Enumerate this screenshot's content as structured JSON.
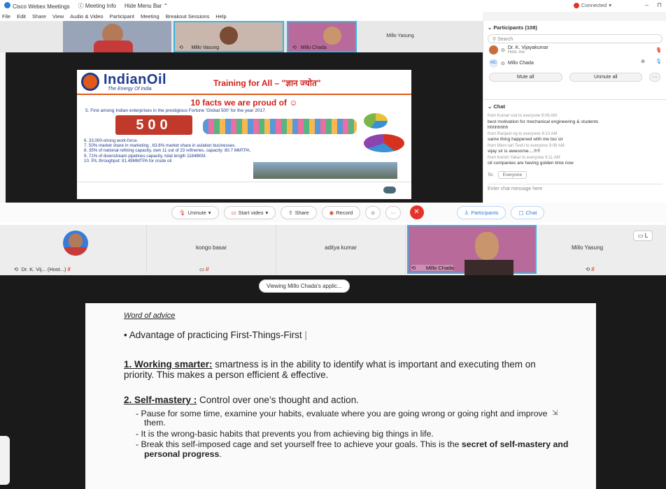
{
  "top": {
    "titlebar": {
      "app": "Cisco Webex Meetings",
      "info": "Meeting Info",
      "hide": "Hide Menu Bar",
      "connected": "Connected"
    },
    "menu": [
      "File",
      "Edit",
      "Share",
      "View",
      "Audio & Video",
      "Participant",
      "Meeting",
      "Breakout Sessions",
      "Help"
    ],
    "thumbs": [
      "",
      "Millo Vasung",
      "Millo Chada",
      "Millo Yasung"
    ],
    "slide": {
      "brand": "IndianOil",
      "brand_sub": "The Energy Of India",
      "title": "Training for All – \"ज्ञान ज्योत\"",
      "facts_title": "10 facts we are proud of ☺",
      "fact1": "5.  First among Indian enterprises in the prestigious Fortune 'Global 500' for the year 2017.",
      "badge": "500",
      "facts": [
        "6.   33,000-strong work-force.",
        "7.   50% market share in marketing , 63.6% market share in aviation businesses.",
        "8.   35% of national refining capacity, own 11 out of 23 refineries, capacity: 80.7 MMTPA.",
        "9.   71% of downstream pipelines capacity, total length 11848KM.",
        "10.  P/L throughput: 81.49MMTPA for crude oil"
      ]
    },
    "controls": {
      "unmute": "Unmute",
      "video": "Start video",
      "share": "Share",
      "record": "Record",
      "more": "···",
      "participants": "Participants",
      "chat": "Chat"
    },
    "panel": {
      "participants_title": "Participants (108)",
      "search_placeholder": "Search",
      "p1_name": "Dr. K. Vijayakumar",
      "p1_sub": "Host, me",
      "p2_name": "Millo Chada",
      "p2_initials": "MC",
      "mute_all": "Mute all",
      "unmute_all": "Unmute all",
      "chat_title": "Chat",
      "messages": [
        {
          "meta": true,
          "text": "from Kumar ssd to everyone   9:06 AM"
        },
        {
          "meta": false,
          "text": "best motivation for mechanical engineering & students"
        },
        {
          "meta": false,
          "text": "hhhhhhhh"
        },
        {
          "meta": true,
          "text": "from Ranjeet raj to everyone   9:10 AM"
        },
        {
          "meta": false,
          "text": "same thing happened with me too sir"
        },
        {
          "meta": true,
          "text": "from Mero tari Teshi to everyone   9:09 AM"
        },
        {
          "meta": false,
          "text": "vijay sir is awesome....!!!!!"
        },
        {
          "meta": true,
          "text": "from Kemin Yakar to everyone   9:11 AM"
        },
        {
          "meta": false,
          "text": "oil companies are having golden time now"
        }
      ],
      "to_label": "To:",
      "to_value": "Everyone",
      "entry_placeholder": "Enter chat message here"
    }
  },
  "bottom": {
    "tiles": [
      {
        "name": "",
        "bottom": "Dr. K. Vij... (Host...)"
      },
      {
        "name": "kongo basar",
        "bottom": ""
      },
      {
        "name": "aditya kumar",
        "bottom": ""
      },
      {
        "name": "",
        "bottom": "Millo Chada"
      },
      {
        "name": "Millo Yasung",
        "bottom": ""
      }
    ],
    "layout_btn": "L",
    "viewing": "Viewing Millo Chada's applic...",
    "doc": {
      "word": "Word of advice",
      "advantage": "• Advantage of practicing First-Things-First",
      "p1_head": "1. Working smarter:",
      "p1_body": " smartness is in the ability to identify what is important and executing them on priority. This makes a person efficient & effective.",
      "p2_head": "2. Self-mastery :",
      "p2_body": " Control over one’s thought and action.",
      "b1": "- Pause for some time, examine your habits, evaluate where you are going wrong or going right and improve them.",
      "b2": "- It is the wrong-basic habits that prevents you from achieving big things in life.",
      "b3_pre": "- Break this self-imposed cage and set yourself free to achieve your goals. This is the ",
      "b3_bold": "secret of self-mastery and personal progress",
      "b3_post": "."
    }
  }
}
